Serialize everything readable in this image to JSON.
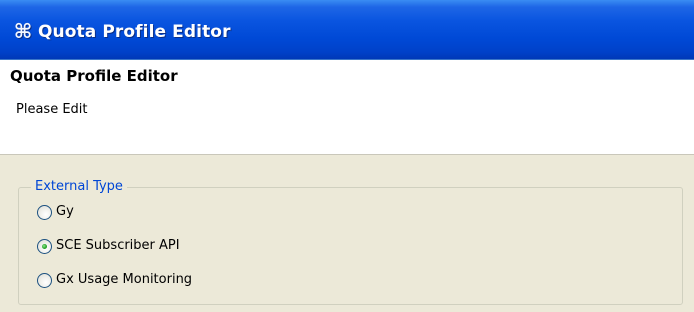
{
  "window": {
    "title": "Quota Profile Editor",
    "icon": "quota-editor-icon"
  },
  "header": {
    "title": "Quota Profile Editor",
    "message": "Please Edit"
  },
  "external_type": {
    "legend": "External Type",
    "options": [
      {
        "label": "Gy",
        "selected": false
      },
      {
        "label": "SCE Subscriber API",
        "selected": true
      },
      {
        "label": "Gx Usage Monitoring",
        "selected": false
      }
    ]
  },
  "colors": {
    "title_bar": "#0a55e0",
    "legend_text": "#0046d5",
    "radio_selected": "#21a121",
    "background": "#ece9d8"
  }
}
